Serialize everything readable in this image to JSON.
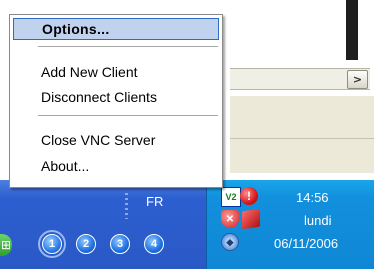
{
  "context_menu": {
    "items": [
      {
        "label": "Options...",
        "highlighted": true,
        "bold": true
      },
      {
        "label": "Add New Client"
      },
      {
        "label": "Disconnect Clients"
      },
      {
        "label": "Close VNC Server"
      },
      {
        "label": "About..."
      }
    ]
  },
  "background_window": {
    "scroll_arrow": ">"
  },
  "taskbar": {
    "language": "FR",
    "quick_launch": [
      {
        "label": "1",
        "active": true
      },
      {
        "label": "2"
      },
      {
        "label": "3"
      },
      {
        "label": "4"
      }
    ]
  },
  "tray": {
    "icons": [
      "vnc-icon",
      "red-alert-icon",
      "security-shield-icon",
      "red-cube-icon",
      "network-icon"
    ],
    "vnc_glyph": "V2",
    "alert_glyph": "!",
    "clock": {
      "time": "14:56",
      "day": "lundi",
      "date": "06/11/2006"
    }
  },
  "colors": {
    "taskbar_blue": "#2a59c6",
    "tray_blue": "#0f87d4",
    "menu_highlight": "#c1d2ee",
    "menu_highlight_border": "#316ac5"
  }
}
